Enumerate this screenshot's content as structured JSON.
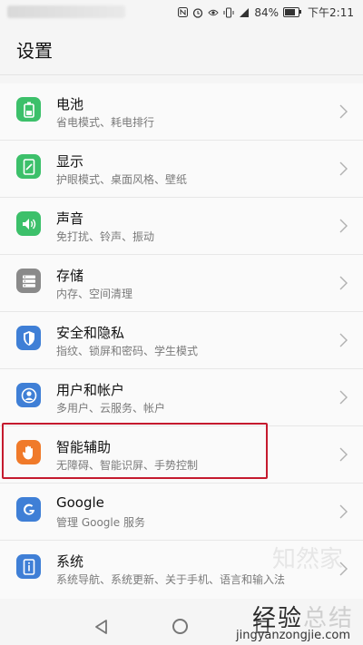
{
  "status_bar": {
    "battery_percent": "84%",
    "time": "下午2:11",
    "icons": [
      "nfc-icon",
      "alarm-icon",
      "eye-icon",
      "vibrate-icon",
      "signal-icon",
      "battery-icon"
    ]
  },
  "page": {
    "title": "设置"
  },
  "items": [
    {
      "label": "电池",
      "sub": "省电模式、耗电排行",
      "icon": "battery-icon",
      "color": "#3cc06a"
    },
    {
      "label": "显示",
      "sub": "护眼模式、桌面风格、壁纸",
      "icon": "display-icon",
      "color": "#3cc06a"
    },
    {
      "label": "声音",
      "sub": "免打扰、铃声、振动",
      "icon": "sound-icon",
      "color": "#3cc06a"
    },
    {
      "label": "存储",
      "sub": "内存、空间清理",
      "icon": "storage-icon",
      "color": "#8a8a8a"
    },
    {
      "label": "安全和隐私",
      "sub": "指纹、锁屏和密码、学生模式",
      "icon": "shield-icon",
      "color": "#3f7fd6"
    },
    {
      "label": "用户和帐户",
      "sub": "多用户、云服务、帐户",
      "icon": "user-icon",
      "color": "#3f7fd6"
    },
    {
      "label": "智能辅助",
      "sub": "无障碍、智能识屏、手势控制",
      "icon": "hand-icon",
      "color": "#f07a2a"
    },
    {
      "label": "Google",
      "sub": "管理 Google 服务",
      "icon": "google-icon",
      "color": "#3f7fd6"
    },
    {
      "label": "系统",
      "sub": "系统导航、系统更新、关于手机、语言和输入法",
      "icon": "system-info-icon",
      "color": "#3f7fd6"
    }
  ],
  "watermark": {
    "logo_main": "经验",
    "logo_tail": "总结",
    "url": "jingyanzongjie.com",
    "faint": "知然家"
  }
}
